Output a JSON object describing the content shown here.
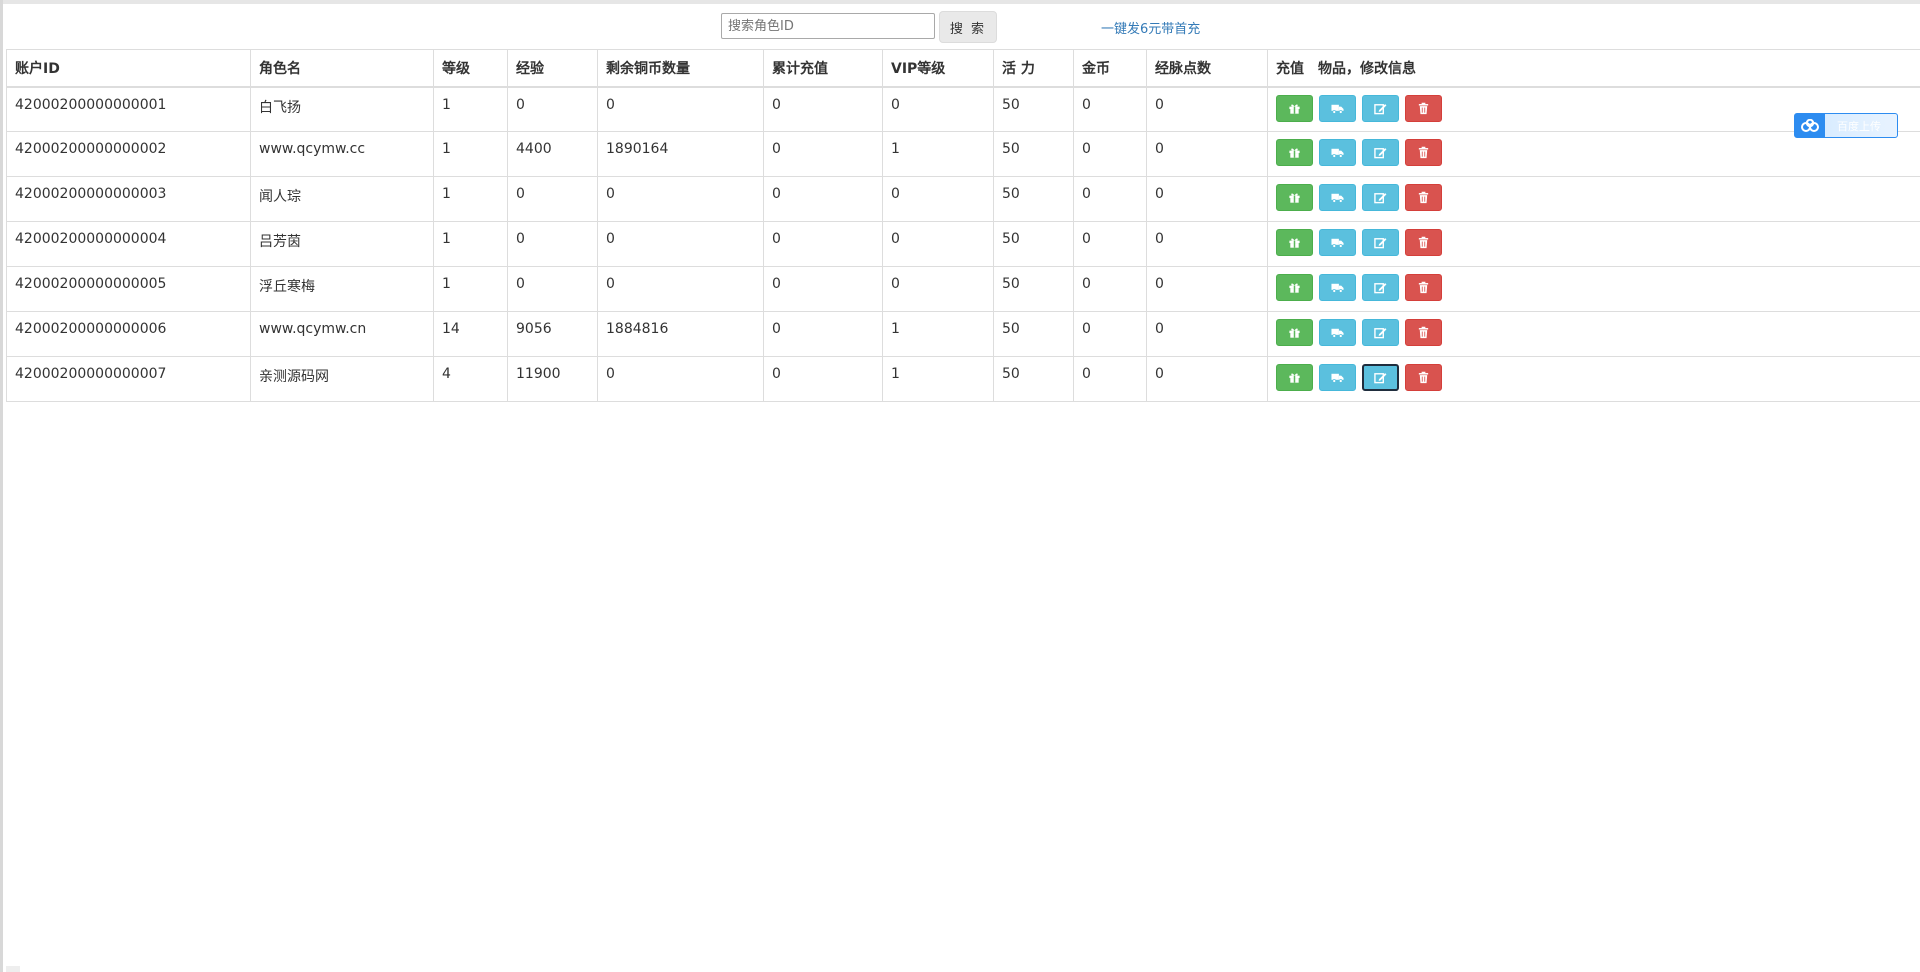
{
  "search": {
    "placeholder": "搜索角色ID",
    "value": "",
    "button_label": "搜 索"
  },
  "promo_link": "一键发6元带首充",
  "table": {
    "headers": [
      "账户ID",
      "角色名",
      "等级",
      "经验",
      "剩余铜币数量",
      "累计充值",
      "VIP等级",
      "活 力",
      "金币",
      "经脉点数",
      "充值　物品，修改信息"
    ],
    "rows": [
      [
        "42000200000000001",
        "白飞扬",
        "1",
        "0",
        "0",
        "0",
        "0",
        "50",
        "0",
        "0"
      ],
      [
        "42000200000000002",
        "www.qcymw.cc",
        "1",
        "4400",
        "1890164",
        "0",
        "1",
        "50",
        "0",
        "0"
      ],
      [
        "42000200000000003",
        "闻人琮",
        "1",
        "0",
        "0",
        "0",
        "0",
        "50",
        "0",
        "0"
      ],
      [
        "42000200000000004",
        "吕芳茵",
        "1",
        "0",
        "0",
        "0",
        "0",
        "50",
        "0",
        "0"
      ],
      [
        "42000200000000005",
        "浮丘寒梅",
        "1",
        "0",
        "0",
        "0",
        "0",
        "50",
        "0",
        "0"
      ],
      [
        "42000200000000006",
        "www.qcymw.cn",
        "14",
        "9056",
        "1884816",
        "0",
        "1",
        "50",
        "0",
        "0"
      ],
      [
        "42000200000000007",
        "亲测源码网",
        "4",
        "11900",
        "0",
        "0",
        "1",
        "50",
        "0",
        "0"
      ]
    ],
    "action_icons": [
      "gift-icon",
      "truck-icon",
      "edit-icon",
      "trash-icon"
    ],
    "focused_action": {
      "row": 6,
      "button": 2
    }
  },
  "widget": {
    "label": "百度上传",
    "icon": "baidu-cloud-icon"
  },
  "colors": {
    "green": "#5cb85c",
    "blue": "#5bc0de",
    "red": "#d9534f",
    "link": "#337ab7",
    "border": "#dddddd"
  }
}
